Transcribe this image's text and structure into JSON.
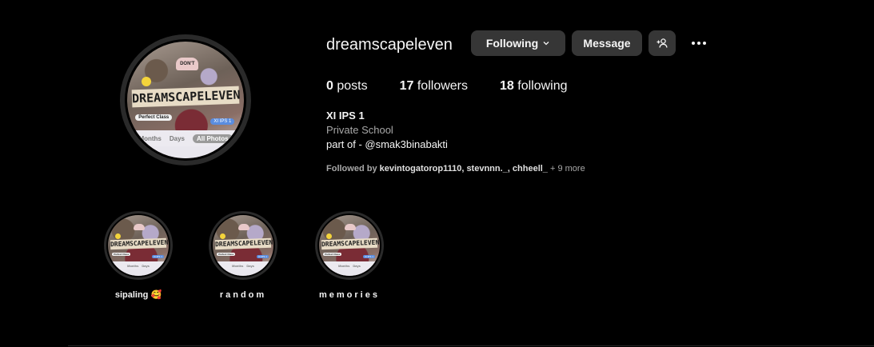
{
  "profile": {
    "username": "dreamscapeleven",
    "avatar_collage": {
      "title": "DREAMSCAPELEVEN",
      "top_chip": "DON'T",
      "left_chip": "Perfect Class",
      "right_chip": "XI IPS 1",
      "tabs": [
        "Months",
        "Days",
        "All Photos"
      ],
      "selected_tab": "All Photos"
    }
  },
  "actions": {
    "following_label": "Following",
    "message_label": "Message"
  },
  "stats": {
    "posts_count": "0",
    "posts_label": "posts",
    "followers_count": "17",
    "followers_label": "followers",
    "following_count": "18",
    "following_label": "following"
  },
  "bio": {
    "name": "XI IPS 1",
    "category": "Private School",
    "text": "part of - @smak3binabakti"
  },
  "followed_by": {
    "prefix": "Followed by ",
    "names": "kevintogatorop1110, stevnnn._, chheell_",
    "more": " + 9 more"
  },
  "highlights": [
    {
      "label": "sipaling 🥰"
    },
    {
      "label": "random"
    },
    {
      "label": "memories"
    }
  ],
  "colors": {
    "background": "#000000",
    "button_bg": "#363636",
    "text_primary": "#f5f5f5",
    "text_secondary": "#a8a8a8"
  }
}
